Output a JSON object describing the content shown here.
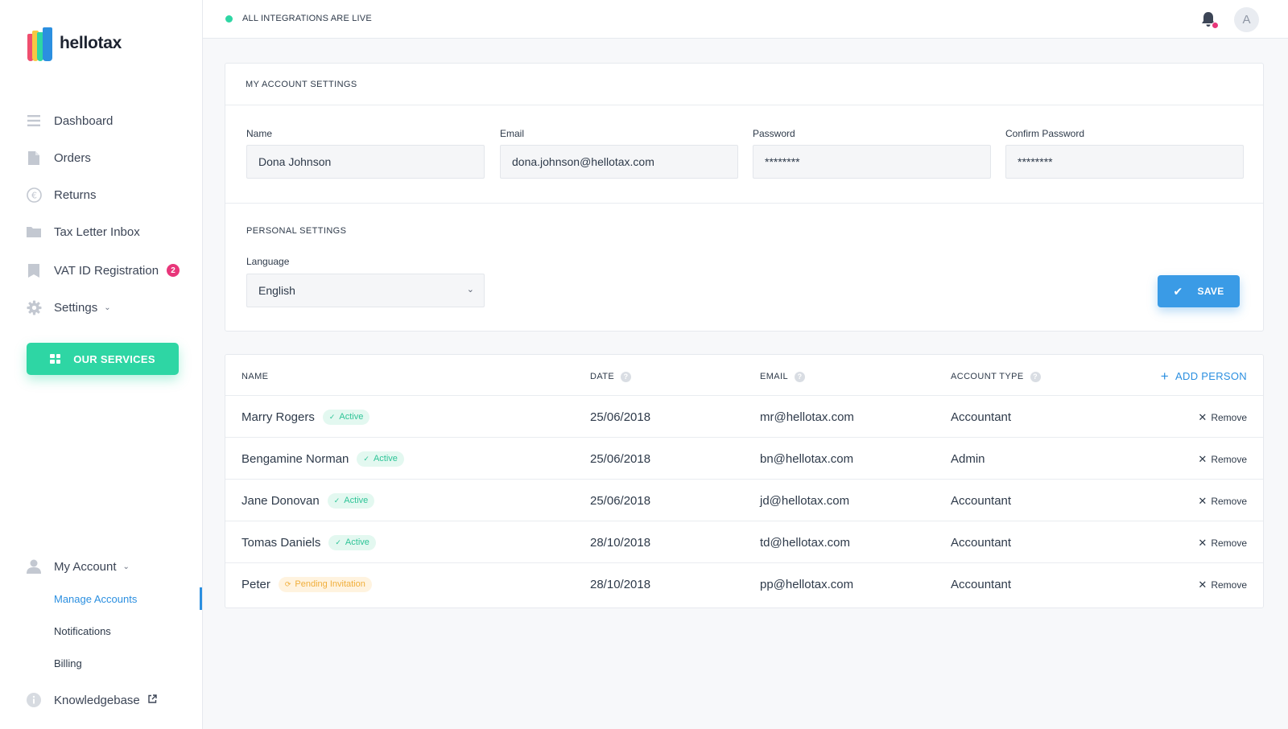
{
  "brand": {
    "name": "hellotax"
  },
  "status_bar": {
    "text": "ALL INTEGRATIONS ARE LIVE"
  },
  "header": {
    "avatar_initial": "A"
  },
  "sidebar": {
    "items": [
      {
        "label": "Dashboard",
        "icon": "dashboard-icon"
      },
      {
        "label": "Orders",
        "icon": "document-icon"
      },
      {
        "label": "Returns",
        "icon": "euro-icon"
      },
      {
        "label": "Tax Letter Inbox",
        "icon": "folder-icon"
      },
      {
        "label": "VAT ID Registration",
        "icon": "file-icon",
        "badge": "2"
      },
      {
        "label": "Settings",
        "icon": "gear-icon"
      }
    ],
    "services_button": "OUR SERVICES",
    "my_account": {
      "label": "My Account",
      "children": [
        "Manage Accounts",
        "Notifications",
        "Billing"
      ]
    },
    "knowledgebase": "Knowledgebase"
  },
  "account_settings": {
    "title": "MY ACCOUNT SETTINGS",
    "fields": [
      {
        "label": "Name",
        "value": "Dona Johnson"
      },
      {
        "label": "Email",
        "value": "dona.johnson@hellotax.com"
      },
      {
        "label": "Password",
        "value": "********"
      },
      {
        "label": "Confirm Password",
        "value": "********"
      }
    ]
  },
  "personal_settings": {
    "title": "PERSONAL SETTINGS",
    "language_label": "Language",
    "language_value": "English",
    "save_label": "SAVE"
  },
  "people_table": {
    "columns": [
      "NAME",
      "DATE",
      "EMAIL",
      "ACCOUNT TYPE"
    ],
    "add_label": "ADD PERSON",
    "remove_label": "Remove",
    "rows": [
      {
        "name": "Marry Rogers",
        "status": "Active",
        "date": "25/06/2018",
        "email": "mr@hellotax.com",
        "type": "Accountant"
      },
      {
        "name": "Bengamine Norman",
        "status": "Active",
        "date": "25/06/2018",
        "email": "bn@hellotax.com",
        "type": "Admin"
      },
      {
        "name": "Jane Donovan",
        "status": "Active",
        "date": "25/06/2018",
        "email": "jd@hellotax.com",
        "type": "Accountant"
      },
      {
        "name": "Tomas Daniels",
        "status": "Active",
        "date": "28/10/2018",
        "email": "td@hellotax.com",
        "type": "Accountant"
      },
      {
        "name": "Peter",
        "status": "Pending Invitation",
        "date": "28/10/2018",
        "email": "pp@hellotax.com",
        "type": "Accountant"
      }
    ]
  }
}
